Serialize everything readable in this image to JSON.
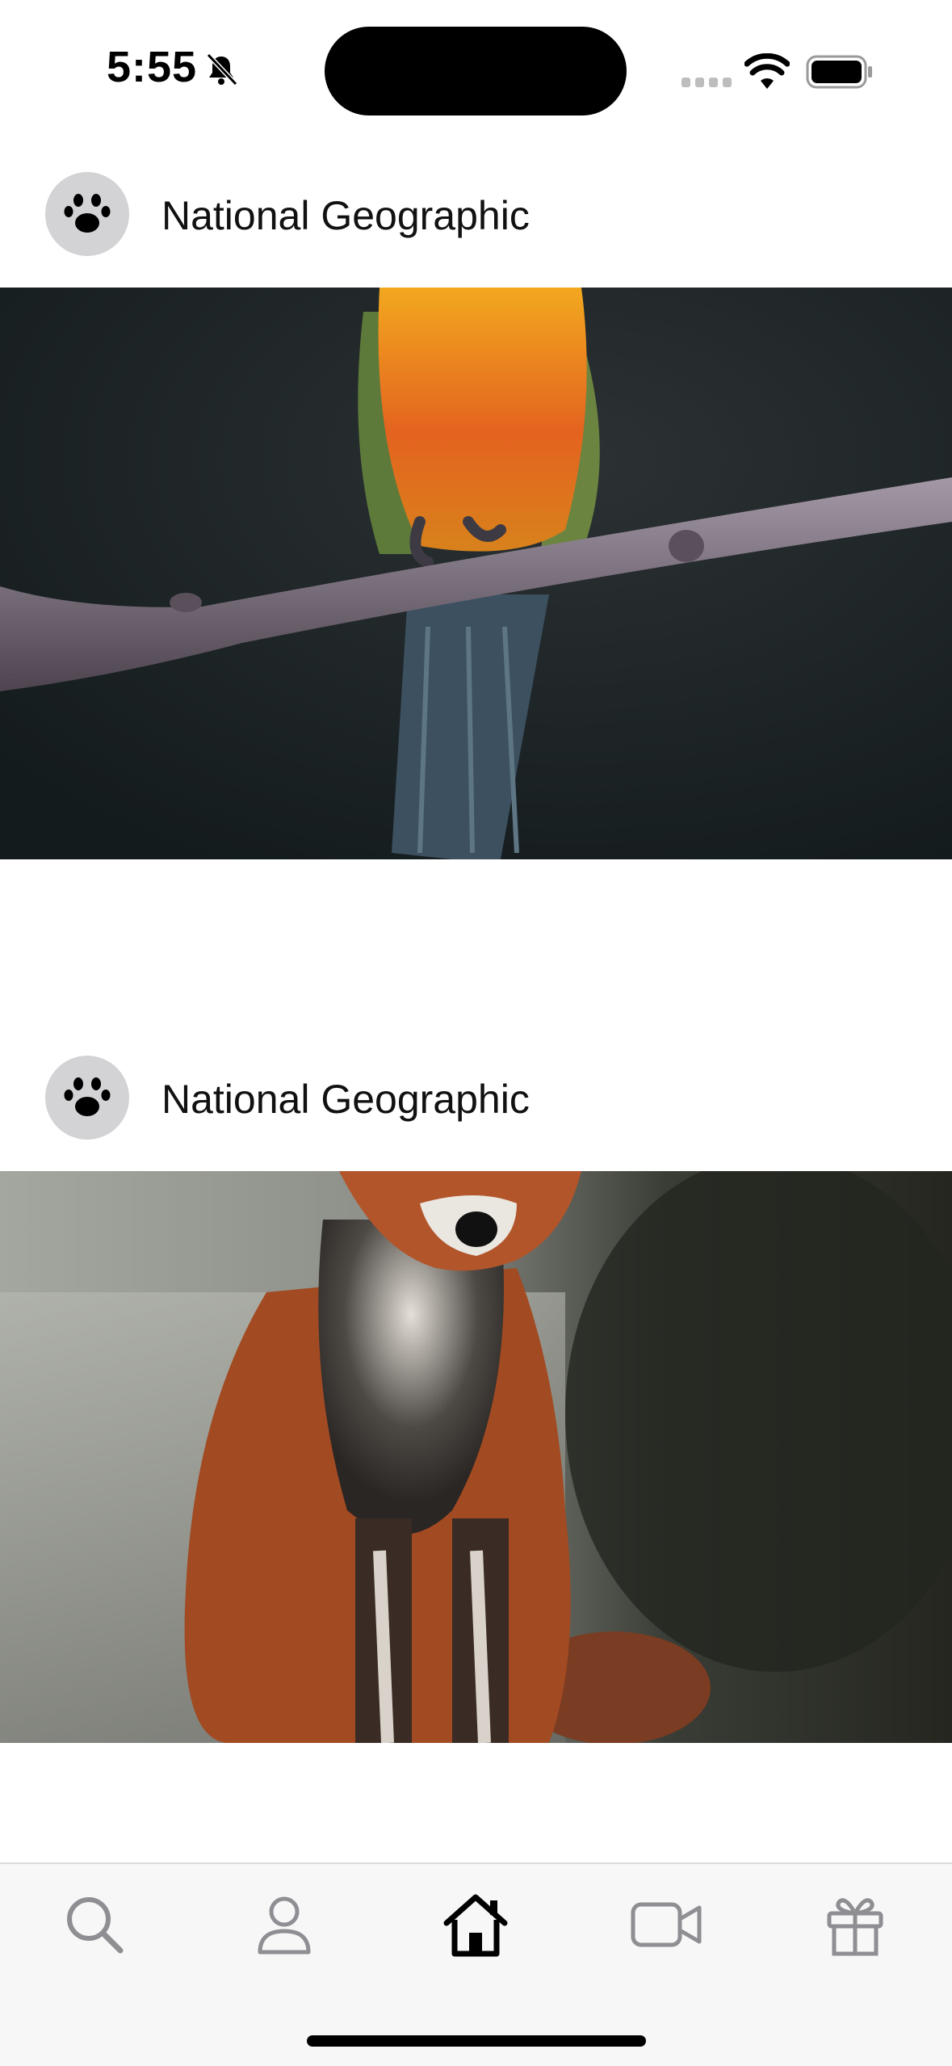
{
  "status_bar": {
    "time": "5:55",
    "icons": [
      "bell-slash-icon",
      "cellular-signal-icon",
      "wifi-icon",
      "battery-icon"
    ]
  },
  "feed": {
    "posts": [
      {
        "author": "National Geographic",
        "avatar_icon": "paw-icon",
        "image": "parrot-on-branch-photo"
      },
      {
        "author": "National Geographic",
        "avatar_icon": "paw-icon",
        "image": "red-fox-photo"
      }
    ]
  },
  "tab_bar": {
    "items": [
      {
        "icon": "search-icon",
        "active": false
      },
      {
        "icon": "profile-icon",
        "active": false
      },
      {
        "icon": "home-icon",
        "active": true
      },
      {
        "icon": "video-icon",
        "active": false
      },
      {
        "icon": "gift-icon",
        "active": false
      }
    ]
  },
  "colors": {
    "background": "#ffffff",
    "avatar_bg": "#d3d3d6",
    "tab_inactive": "#8e8e93",
    "tab_active": "#000000"
  }
}
